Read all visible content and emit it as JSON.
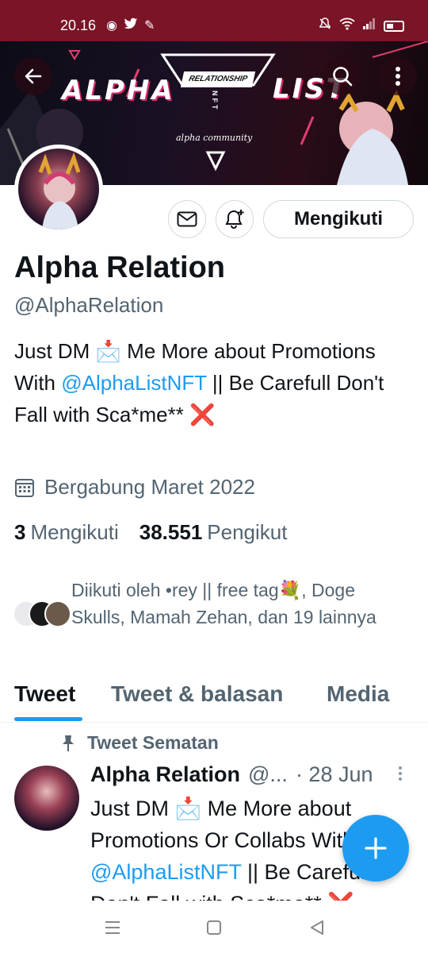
{
  "status_bar": {
    "time": "20.16"
  },
  "banner": {
    "word_left": "ALPHA",
    "word_right": "LIST",
    "tag": "RELATIONSHIP",
    "nft": "NFT",
    "sub": "alpha community"
  },
  "profile": {
    "name": "Alpha Relation",
    "handle": "@AlphaRelation",
    "follow_button": "Mengikuti",
    "bio_part1": "Just DM 📩 Me More about Promotions With ",
    "bio_link": "@AlphaListNFT",
    "bio_part2": " || Be Carefull Don't Fall with Sca*me** ❌",
    "joined": "Bergabung Maret 2022",
    "following_count": "3",
    "following_label": "Mengikuti",
    "followers_count": "38.551",
    "followers_label": "Pengikut",
    "followed_by": "Diikuti oleh •rey || free tag💐, Doge Skulls, Mamah Zehan, dan 19 lainnya"
  },
  "tabs": [
    {
      "label": "Tweet"
    },
    {
      "label": "Tweet & balasan"
    },
    {
      "label": "Media"
    }
  ],
  "pinned_tweet": {
    "pinned_label": "Tweet Sematan",
    "author": "Alpha Relation",
    "handle_trunc": "@...",
    "date": "· 28 Jun",
    "text_part1": "Just DM 📩 Me More about Promotions Or Collabs With ",
    "text_link": "@AlphaListNFT",
    "text_part2": " || Be Carefull Don't Fall with Sca*me** ❌"
  },
  "colors": {
    "status_bar": "#7a1426",
    "accent": "#1d9bf0",
    "text_primary": "#0f1419",
    "text_secondary": "#536471"
  }
}
